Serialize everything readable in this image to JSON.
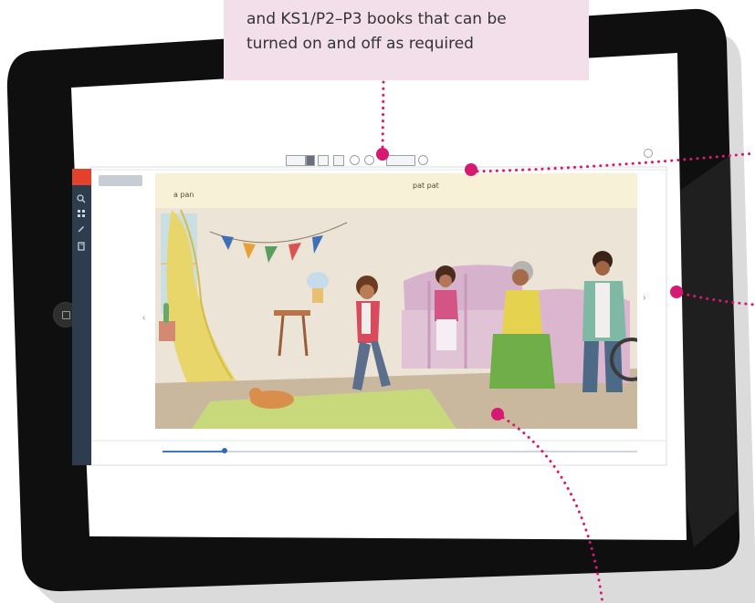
{
  "callout": {
    "line1": "and KS1/P2–P3 books that can be",
    "line2": "turned on and off as required"
  },
  "colors": {
    "tablet_body": "#0f0f10",
    "callout_bg": "#f3dfe9",
    "callout_dot": "#d61a73",
    "sidebar": "#2d3d4e",
    "sidebar_logo": "#e2412c",
    "progress": "#3a78c8"
  },
  "viewer": {
    "sidebar_icons": [
      "search-icon",
      "grid-icon",
      "pencil-icon",
      "book-icon"
    ],
    "page_left_text": "a pan",
    "page_right_text": "pat pat",
    "progress_fraction": 0.13
  }
}
